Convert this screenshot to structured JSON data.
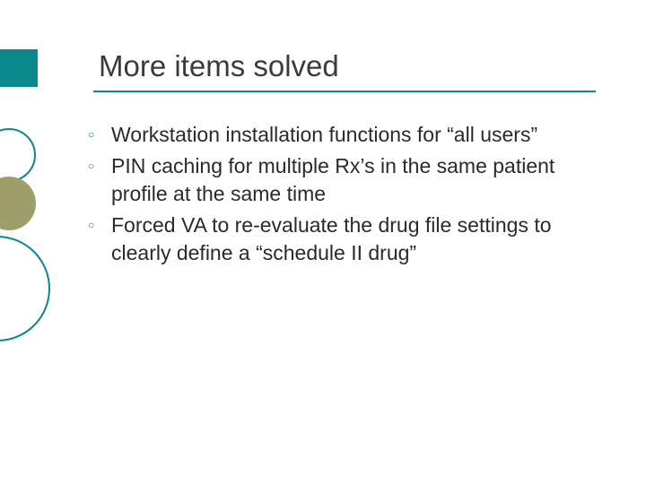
{
  "title": "More items solved",
  "bullets": [
    {
      "text": "Workstation installation functions for “all users”"
    },
    {
      "text": "PIN caching for multiple Rx’s in the same patient profile at the same time"
    },
    {
      "text": "Forced VA to re-evaluate the drug file settings to clearly define a “schedule II drug”"
    }
  ]
}
